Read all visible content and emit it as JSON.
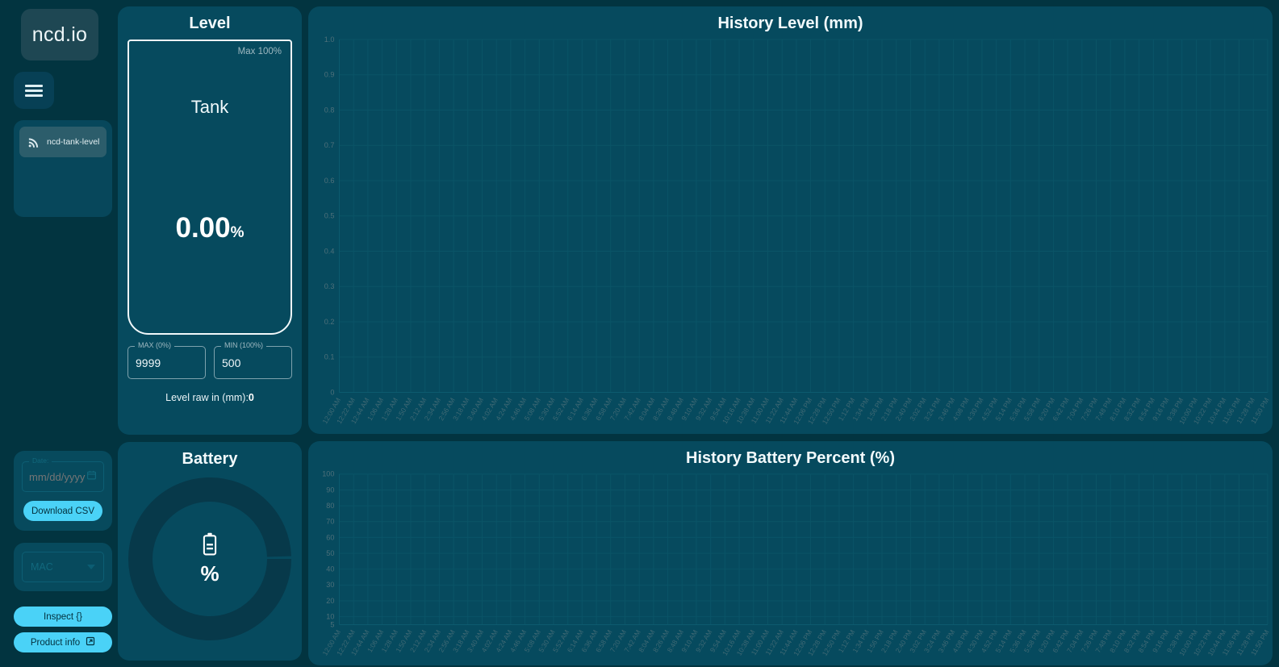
{
  "colors": {
    "background": "#023440",
    "panel": "#064a5e",
    "accent": "#4ad2f7",
    "text": "#f2fafc",
    "muted": "#9fb9c1",
    "grid": "#0a5467"
  },
  "sidebar": {
    "logo": "ncd.io",
    "menu_button_icon": "hamburger-icon",
    "devices": [
      {
        "label": "ncd-tank-level",
        "icon": "rss-signal-icon",
        "selected": true
      }
    ],
    "date_label": "Date:",
    "date_value": "",
    "date_placeholder": "mm/dd/yyyy",
    "download_csv_label": "Download CSV",
    "mac_select_value": "MAC",
    "inspect_label": "Inspect  {}",
    "product_info_label": "Product info"
  },
  "level_panel": {
    "title": "Level",
    "max_label": "Max 100%",
    "tank_name": "Tank",
    "value": "0.00",
    "value_unit": "%",
    "max_field_label": "MAX (0%)",
    "max_field_value": "9999",
    "min_field_label": "MIN (100%)",
    "min_field_value": "500",
    "raw_label": "Level raw in (mm):",
    "raw_value": "0"
  },
  "battery_panel": {
    "title": "Battery",
    "icon": "battery-icon",
    "value": "",
    "unit": "%"
  },
  "chart_data": [
    {
      "type": "line",
      "title": "History Level (mm)",
      "xlabel": "",
      "ylabel": "",
      "ylim": [
        0,
        1.0
      ],
      "yticks": [
        "0",
        "0.1",
        "0.2",
        "0.3",
        "0.4",
        "0.5",
        "0.6",
        "0.7",
        "0.8",
        "0.9",
        "1.0"
      ],
      "grid": true,
      "legend": "none",
      "series": [
        {
          "name": "Level (mm)",
          "values": []
        }
      ],
      "categories": [
        "12:00 AM",
        "12:22 AM",
        "12:44 AM",
        "1:06 AM",
        "1:28 AM",
        "1:50 AM",
        "2:12 AM",
        "2:34 AM",
        "2:56 AM",
        "3:18 AM",
        "3:40 AM",
        "4:02 AM",
        "4:24 AM",
        "4:46 AM",
        "5:08 AM",
        "5:30 AM",
        "5:52 AM",
        "6:14 AM",
        "6:36 AM",
        "6:58 AM",
        "7:20 AM",
        "7:42 AM",
        "8:04 AM",
        "8:26 AM",
        "8:48 AM",
        "9:10 AM",
        "9:32 AM",
        "9:54 AM",
        "10:16 AM",
        "10:38 AM",
        "11:00 AM",
        "11:22 AM",
        "11:44 AM",
        "12:06 PM",
        "12:28 PM",
        "12:50 PM",
        "1:12 PM",
        "1:34 PM",
        "1:56 PM",
        "2:18 PM",
        "2:40 PM",
        "3:02 PM",
        "3:24 PM",
        "3:46 PM",
        "4:08 PM",
        "4:30 PM",
        "4:52 PM",
        "5:14 PM",
        "5:36 PM",
        "5:58 PM",
        "6:20 PM",
        "6:42 PM",
        "7:04 PM",
        "7:26 PM",
        "7:48 PM",
        "8:10 PM",
        "8:32 PM",
        "8:54 PM",
        "9:16 PM",
        "9:38 PM",
        "10:00 PM",
        "10:22 PM",
        "10:44 PM",
        "11:06 PM",
        "11:28 PM",
        "11:50 PM"
      ]
    },
    {
      "type": "line",
      "title": "History Battery Percent (%)",
      "xlabel": "",
      "ylabel": "",
      "ylim": [
        5,
        100
      ],
      "yticks": [
        "5",
        "10",
        "20",
        "30",
        "40",
        "50",
        "60",
        "70",
        "80",
        "90",
        "100"
      ],
      "grid": true,
      "legend": "none",
      "series": [
        {
          "name": "Battery Percent (%)",
          "values": []
        }
      ],
      "categories": [
        "12:00 AM",
        "12:22 AM",
        "12:44 AM",
        "1:06 AM",
        "1:28 AM",
        "1:50 AM",
        "2:12 AM",
        "2:34 AM",
        "2:56 AM",
        "3:18 AM",
        "3:40 AM",
        "4:02 AM",
        "4:24 AM",
        "4:46 AM",
        "5:08 AM",
        "5:30 AM",
        "5:52 AM",
        "6:14 AM",
        "6:36 AM",
        "6:58 AM",
        "7:20 AM",
        "7:42 AM",
        "8:04 AM",
        "8:26 AM",
        "8:48 AM",
        "9:10 AM",
        "9:32 AM",
        "9:54 AM",
        "10:16 AM",
        "10:38 AM",
        "11:00 AM",
        "11:22 AM",
        "11:44 AM",
        "12:06 PM",
        "12:28 PM",
        "12:50 PM",
        "1:12 PM",
        "1:34 PM",
        "1:56 PM",
        "2:18 PM",
        "2:40 PM",
        "3:02 PM",
        "3:24 PM",
        "3:46 PM",
        "4:08 PM",
        "4:30 PM",
        "4:52 PM",
        "5:14 PM",
        "5:36 PM",
        "5:58 PM",
        "6:20 PM",
        "6:42 PM",
        "7:04 PM",
        "7:26 PM",
        "7:48 PM",
        "8:10 PM",
        "8:32 PM",
        "8:54 PM",
        "9:16 PM",
        "9:38 PM",
        "10:00 PM",
        "10:22 PM",
        "10:44 PM",
        "11:06 PM",
        "11:28 PM",
        "11:50 PM"
      ]
    }
  ]
}
